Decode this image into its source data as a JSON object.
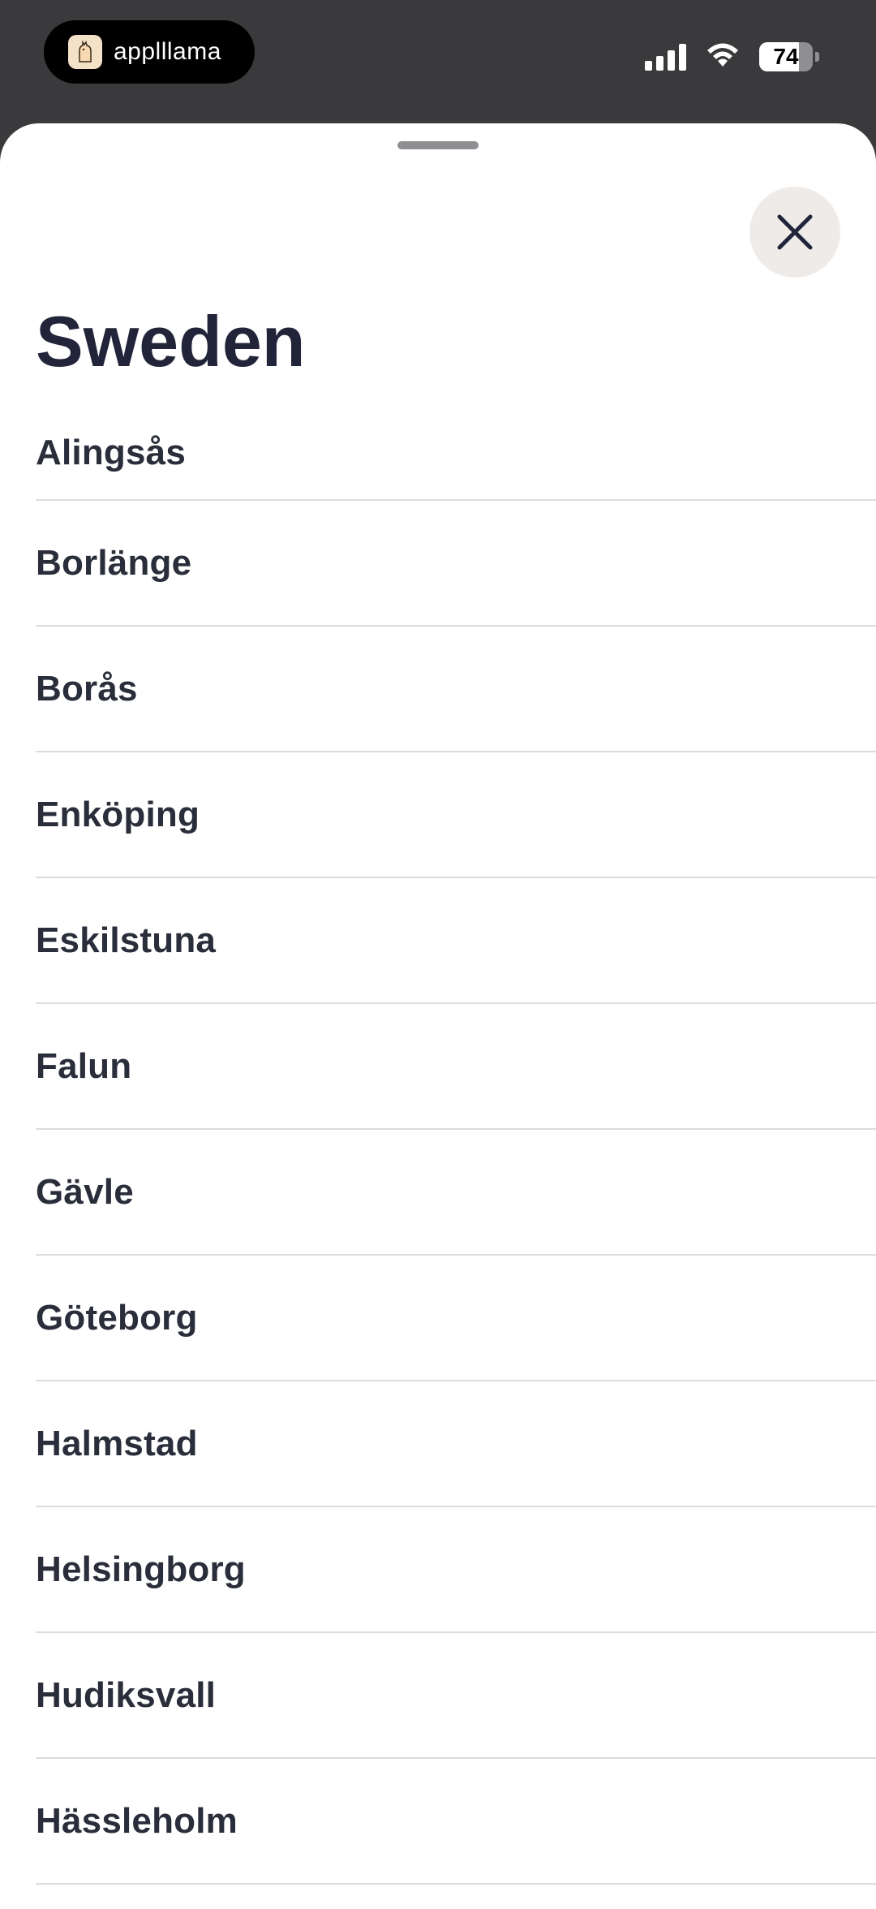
{
  "status_bar": {
    "app_name": "applllama",
    "battery_level": "74",
    "battery_fraction": 0.74
  },
  "sheet": {
    "title": "Sweden",
    "close_icon": "close-icon",
    "cities": [
      {
        "label": "Alingsås"
      },
      {
        "label": "Borlänge"
      },
      {
        "label": "Borås"
      },
      {
        "label": "Enköping"
      },
      {
        "label": "Eskilstuna"
      },
      {
        "label": "Falun"
      },
      {
        "label": "Gävle"
      },
      {
        "label": "Göteborg"
      },
      {
        "label": "Halmstad"
      },
      {
        "label": "Helsingborg"
      },
      {
        "label": "Hudiksvall"
      },
      {
        "label": "Hässleholm"
      }
    ]
  },
  "colors": {
    "title": "#22253a",
    "status_background": "#3a3a3c",
    "close_background": "#efebe8"
  }
}
